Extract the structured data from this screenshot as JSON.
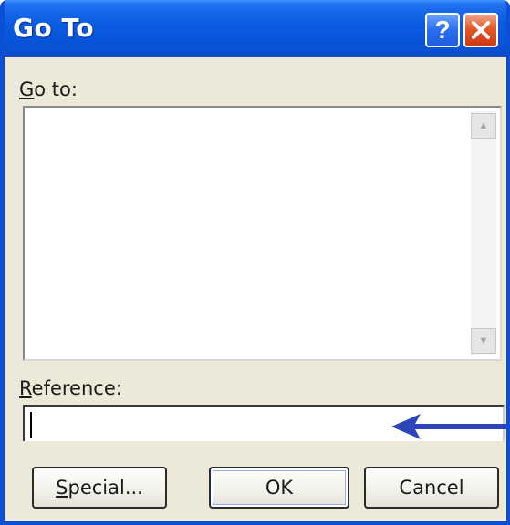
{
  "window": {
    "title": "Go To",
    "accent": "#0a5ae0",
    "close_color": "#e2582a",
    "help_glyph": "?"
  },
  "goto_label": {
    "prefix": "G",
    "rest": "o to:"
  },
  "list": {
    "items": []
  },
  "reference_label": {
    "prefix": "R",
    "rest": "eference:"
  },
  "reference": {
    "value": ""
  },
  "annotation": {
    "icon": "arrow-left-icon",
    "color": "#2c45b8"
  },
  "buttons": {
    "special": {
      "prefix": "S",
      "rest": "pecial..."
    },
    "ok": "OK",
    "cancel": "Cancel"
  }
}
